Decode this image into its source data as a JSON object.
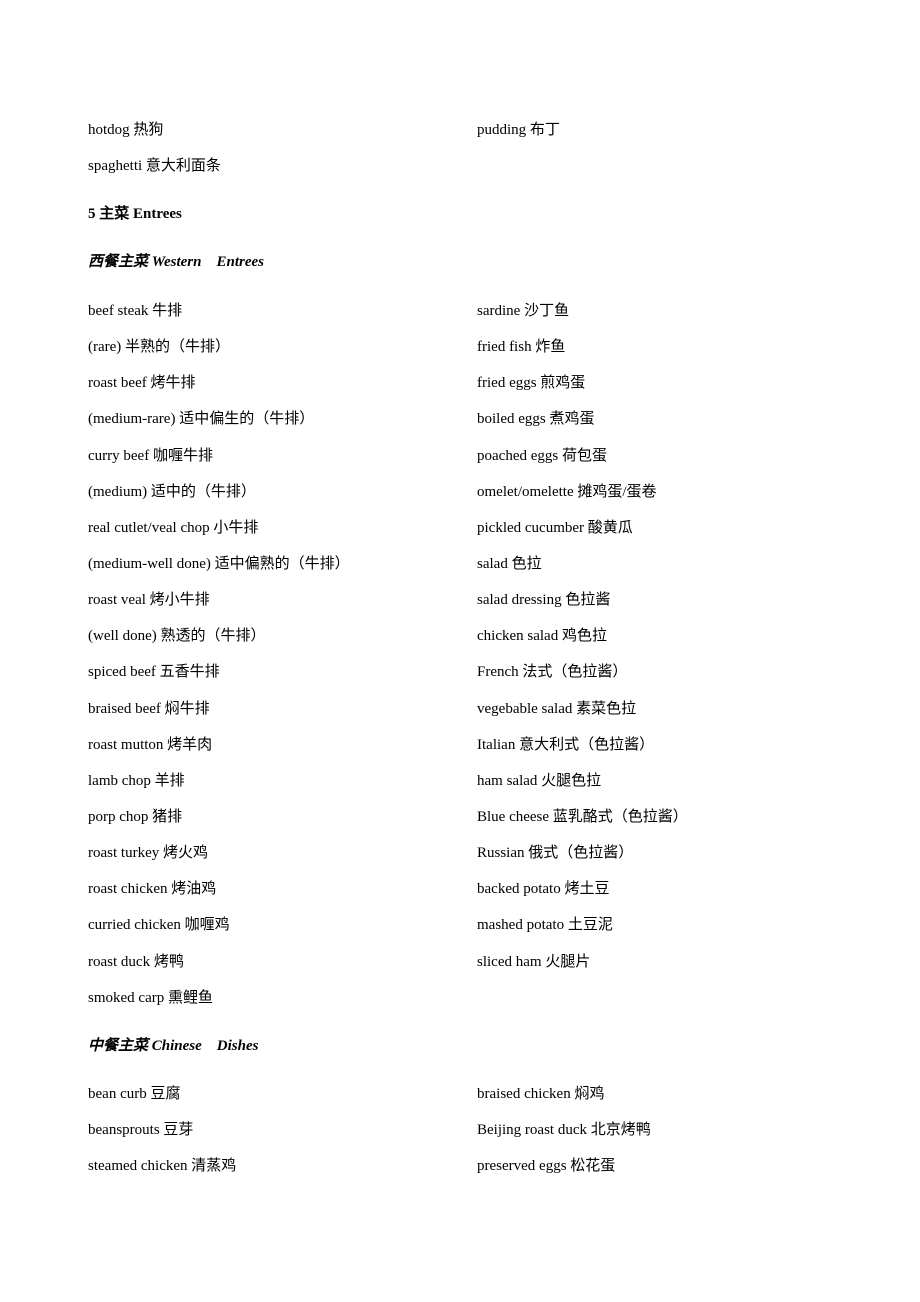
{
  "top_rows": [
    {
      "left": "hotdog 热狗",
      "right": "pudding 布丁"
    },
    {
      "left": "spaghetti 意大利面条",
      "right": ""
    }
  ],
  "section_heading": "5 主菜 Entrees",
  "western": {
    "heading": "西餐主菜 Western    Entrees",
    "rows": [
      {
        "left": "beef steak 牛排",
        "right": "sardine 沙丁鱼"
      },
      {
        "left": "(rare) 半熟的（牛排）",
        "right": "fried fish 炸鱼"
      },
      {
        "left": "roast beef 烤牛排",
        "right": "fried eggs 煎鸡蛋"
      },
      {
        "left": "(medium-rare) 适中偏生的（牛排）",
        "right": "boiled eggs 煮鸡蛋"
      },
      {
        "left": "curry beef 咖喱牛排",
        "right": "poached eggs 荷包蛋"
      },
      {
        "left": "(medium) 适中的（牛排）",
        "right": "omelet/omelette 摊鸡蛋/蛋卷"
      },
      {
        "left": "real cutlet/veal chop 小牛排",
        "right": "pickled cucumber 酸黄瓜"
      },
      {
        "left": "(medium-well done) 适中偏熟的（牛排）",
        "right": "salad 色拉"
      },
      {
        "left": "roast veal 烤小牛排",
        "right": "salad dressing 色拉酱"
      },
      {
        "left": "(well done) 熟透的（牛排）",
        "right": "chicken salad 鸡色拉"
      },
      {
        "left": "spiced beef 五香牛排",
        "right": "French 法式（色拉酱）"
      },
      {
        "left": "braised beef 焖牛排",
        "right": "vegebable salad 素菜色拉"
      },
      {
        "left": "roast mutton 烤羊肉",
        "right": "Italian 意大利式（色拉酱）"
      },
      {
        "left": "lamb chop 羊排",
        "right": "ham salad 火腿色拉"
      },
      {
        "left": "porp chop 猪排",
        "right": "Blue cheese 蓝乳酪式（色拉酱）"
      },
      {
        "left": "roast turkey 烤火鸡",
        "right": "Russian 俄式（色拉酱）"
      },
      {
        "left": "roast chicken 烤油鸡",
        "right": "backed potato 烤土豆"
      },
      {
        "left": "curried chicken 咖喱鸡",
        "right": "mashed potato 土豆泥"
      },
      {
        "left": "roast duck 烤鸭",
        "right": "sliced ham 火腿片"
      },
      {
        "left": "smoked carp 熏鲤鱼",
        "right": ""
      }
    ]
  },
  "chinese": {
    "heading": "中餐主菜 Chinese    Dishes",
    "rows": [
      {
        "left": "bean curb 豆腐",
        "right": "braised chicken 焖鸡"
      },
      {
        "left": "beansprouts 豆芽",
        "right": "Beijing roast duck 北京烤鸭"
      },
      {
        "left": "steamed chicken 清蒸鸡",
        "right": "preserved eggs 松花蛋"
      }
    ]
  }
}
